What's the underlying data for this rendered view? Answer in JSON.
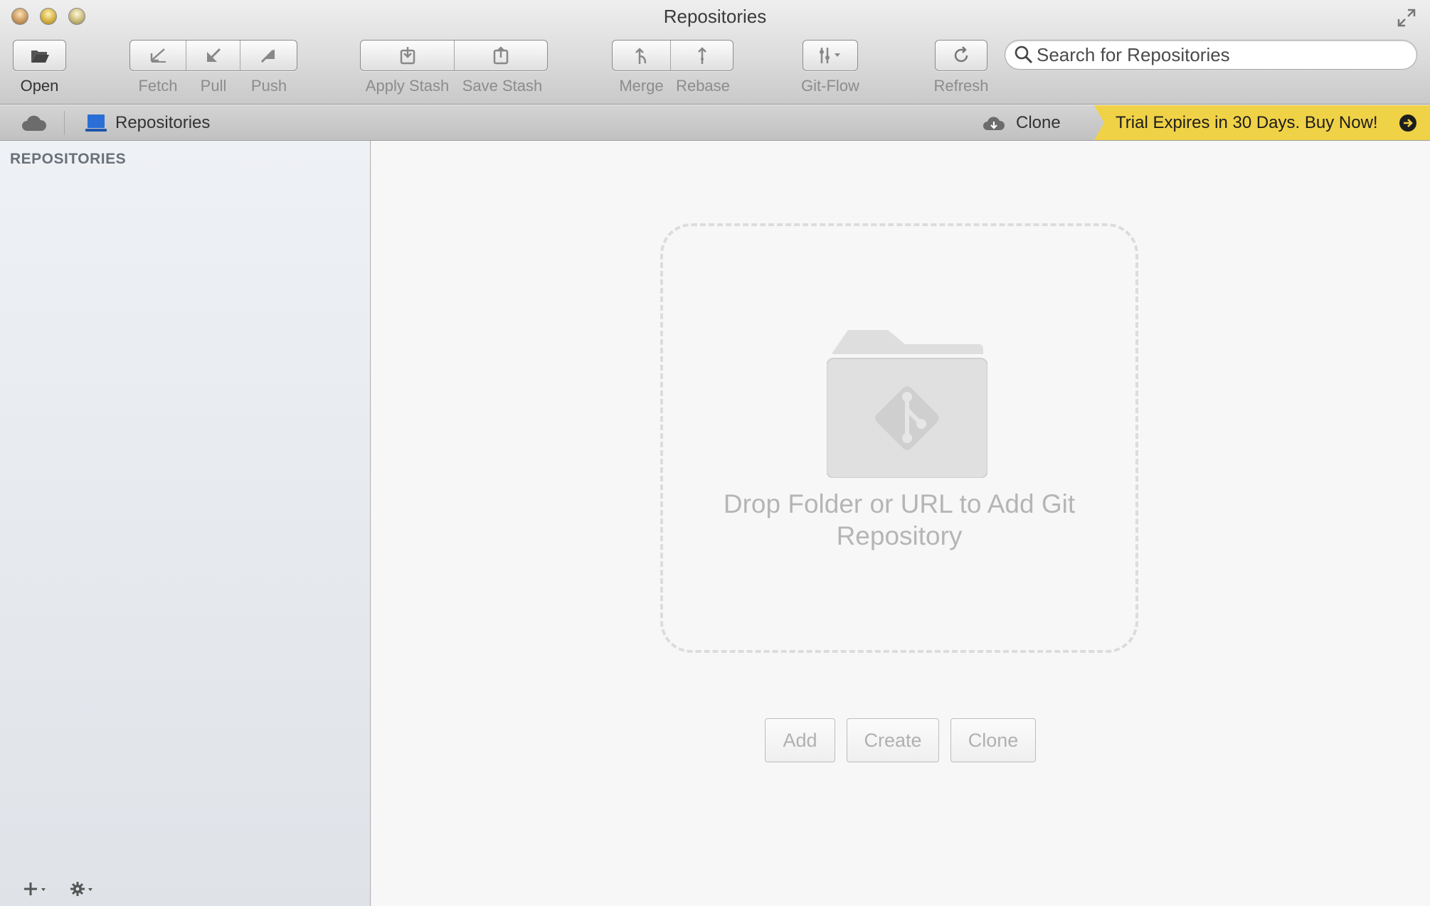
{
  "window": {
    "title": "Repositories"
  },
  "toolbar": {
    "open_label": "Open",
    "fetch_label": "Fetch",
    "pull_label": "Pull",
    "push_label": "Push",
    "apply_stash_label": "Apply Stash",
    "save_stash_label": "Save Stash",
    "merge_label": "Merge",
    "rebase_label": "Rebase",
    "gitflow_label": "Git-Flow",
    "refresh_label": "Refresh",
    "search_placeholder": "Search for Repositories"
  },
  "navbar": {
    "repositories_tab": "Repositories",
    "clone_label": "Clone",
    "trial_banner": "Trial Expires in 30 Days. Buy Now!",
    "banner_color": "#f0d247"
  },
  "sidebar": {
    "heading": "REPOSITORIES",
    "icons": [
      "plus-icon",
      "gear-icon"
    ]
  },
  "main": {
    "drop_text": "Drop Folder or URL to Add Git Repository",
    "buttons": {
      "add": "Add",
      "create": "Create",
      "clone": "Clone"
    }
  },
  "colors": {
    "accent_blue": "#2a6fd6",
    "banner_yellow": "#f0d247"
  }
}
